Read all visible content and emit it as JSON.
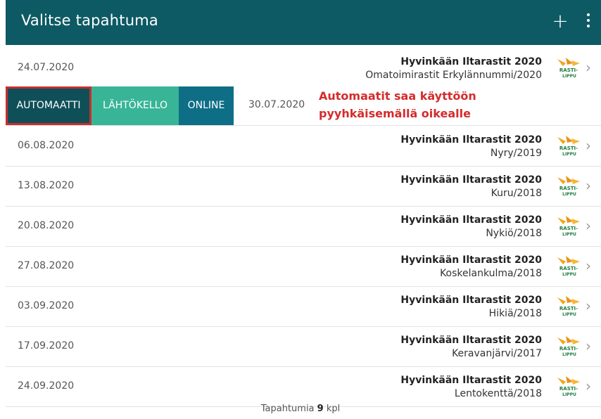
{
  "header": {
    "title": "Valitse tapahtuma",
    "add_icon": "plus-icon",
    "menu_icon": "more-vertical-icon",
    "color": "#0d5a64"
  },
  "swiped_row": {
    "actions": [
      "AUTOMAATTI",
      "LÄHTÖKELLO",
      "ONLINE"
    ],
    "date": "30.07.2020"
  },
  "annotation": {
    "line1": "Automaatit saa käyttöön",
    "line2": "pyyhkäisemällä oikealle",
    "color": "#d52b2b"
  },
  "events": [
    {
      "date": "24.07.2020",
      "name": "Hyvinkään Iltarastit 2020",
      "place": "Omatoimirastit Erkylännummi/2020"
    },
    {
      "date": "06.08.2020",
      "name": "Hyvinkään Iltarastit 2020",
      "place": "Nyry/2019"
    },
    {
      "date": "13.08.2020",
      "name": "Hyvinkään Iltarastit 2020",
      "place": "Kuru/2018"
    },
    {
      "date": "20.08.2020",
      "name": "Hyvinkään Iltarastit 2020",
      "place": "Nykiö/2018"
    },
    {
      "date": "27.08.2020",
      "name": "Hyvinkään Iltarastit 2020",
      "place": "Koskelankulma/2018"
    },
    {
      "date": "03.09.2020",
      "name": "Hyvinkään Iltarastit 2020",
      "place": "Hikiä/2018"
    },
    {
      "date": "17.09.2020",
      "name": "Hyvinkään Iltarastit 2020",
      "place": "Keravanjärvi/2017"
    },
    {
      "date": "24.09.2020",
      "name": "Hyvinkään Iltarastit 2020",
      "place": "Lentokenttä/2018"
    }
  ],
  "logo_text": {
    "line1": "RASTI-",
    "line2": "LIPPU"
  },
  "footer": {
    "prefix": "Tapahtumia",
    "count": "9",
    "suffix": "kpl"
  }
}
